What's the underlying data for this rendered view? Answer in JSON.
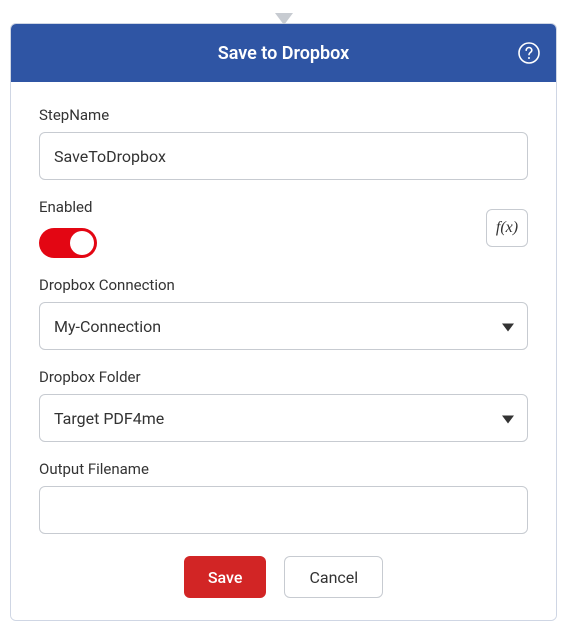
{
  "header": {
    "title": "Save to Dropbox"
  },
  "fields": {
    "stepName": {
      "label": "StepName",
      "value": "SaveToDropbox"
    },
    "enabled": {
      "label": "Enabled",
      "value": true
    },
    "fxButton": {
      "label": "f(x)"
    },
    "dropboxConnection": {
      "label": "Dropbox Connection",
      "value": "My-Connection"
    },
    "dropboxFolder": {
      "label": "Dropbox Folder",
      "value": "Target PDF4me"
    },
    "outputFilename": {
      "label": "Output Filename",
      "value": ""
    }
  },
  "buttons": {
    "save": "Save",
    "cancel": "Cancel"
  }
}
